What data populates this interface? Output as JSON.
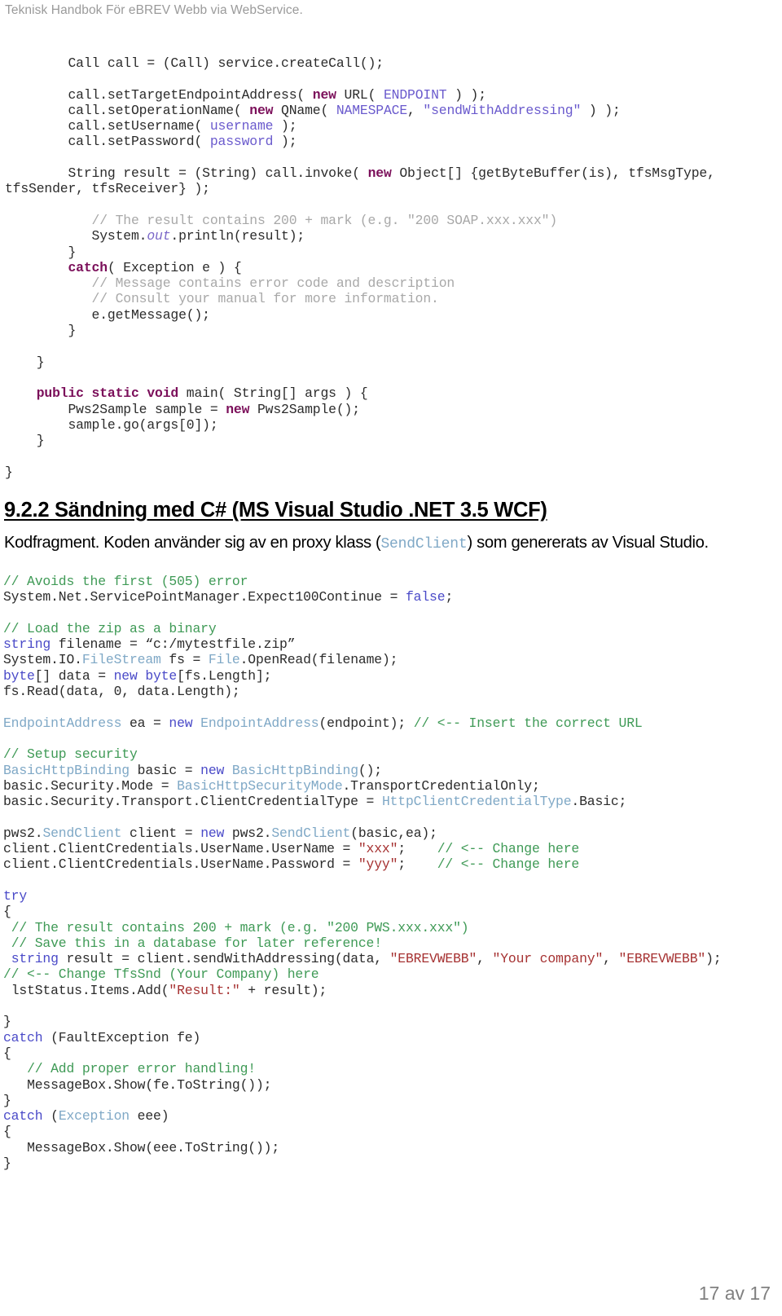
{
  "header": {
    "running_title": "Teknisk Handbok För eBREV Webb via WebService."
  },
  "footer": {
    "page_label": "17 av 17"
  },
  "colors": {
    "header_text": "#9a9a9a",
    "footer_text": "#808080",
    "java_keyword": "#7b0f5a",
    "java_constant": "#6a5acd",
    "java_comment": "#a8a8a8",
    "csharp_comment": "#3f9a56",
    "csharp_keyword": "#4a4ac8",
    "csharp_type": "#7fa8c6",
    "csharp_string": "#a63232",
    "body_text": "#000000"
  },
  "java_code": {
    "language": "java",
    "lines": [
      "        Call call = (Call) service.createCall();",
      "",
      "        call.setTargetEndpointAddress( new URL( ENDPOINT ) );",
      "        call.setOperationName( new QName( NAMESPACE, \"sendWithAddressing\" ) );",
      "        call.setUsername( username );",
      "        call.setPassword( password );",
      "",
      "        String result = (String) call.invoke( new Object[] {getByteBuffer(is), tfsMsgType, tfsSender, tfsReceiver} );",
      "",
      "           // The result contains 200 + mark (e.g. \"200 SOAP.xxx.xxx\")",
      "           System.out.println(result);",
      "        }",
      "        catch( Exception e ) {",
      "           // Message contains error code and description",
      "           // Consult your manual for more information.",
      "           e.getMessage();",
      "        }",
      "",
      "    }",
      "",
      "    public static void main( String[] args ) {",
      "        Pws2Sample sample = new Pws2Sample();",
      "        sample.go(args[0]);",
      "    }",
      "",
      "}"
    ]
  },
  "section": {
    "heading": "9.2.2 Sändning med C# (MS Visual Studio .NET 3.5 WCF)",
    "intro_before": "Kodfragment. Koden använder sig av en proxy klass (",
    "intro_code": "SendClient",
    "intro_after": ") som genererats av Visual Studio."
  },
  "csharp_code": {
    "language": "csharp",
    "lines": [
      "// Avoids the first (505) error",
      "System.Net.ServicePointManager.Expect100Continue = false;",
      "",
      "// Load the zip as a binary",
      "string filename = “c:/mytestfile.zip”",
      "System.IO.FileStream fs = File.OpenRead(filename);",
      "byte[] data = new byte[fs.Length];",
      "fs.Read(data, 0, data.Length);",
      "",
      "EndpointAddress ea = new EndpointAddress(endpoint); // <-- Insert the correct URL",
      "",
      "// Setup security",
      "BasicHttpBinding basic = new BasicHttpBinding();",
      "basic.Security.Mode = BasicHttpSecurityMode.TransportCredentialOnly;",
      "basic.Security.Transport.ClientCredentialType = HttpClientCredentialType.Basic;",
      "",
      "pws2.SendClient client = new pws2.SendClient(basic,ea);",
      "client.ClientCredentials.UserName.UserName = \"xxx\";    // <-- Change here",
      "client.ClientCredentials.UserName.Password = \"yyy\";    // <-- Change here",
      "",
      "try",
      "{",
      " // The result contains 200 + mark (e.g. \"200 PWS.xxx.xxx\")",
      " // Save this in a database for later reference!",
      " string result = client.sendWithAddressing(data, \"EBREVWEBB\", \"Your company\", \"EBREVWEBB\");",
      "// <-- Change TfsSnd (Your Company) here",
      " lstStatus.Items.Add(\"Result:\" + result);",
      "",
      "}",
      "catch (FaultException fe)",
      "{",
      "   // Add proper error handling!",
      "   MessageBox.Show(fe.ToString());",
      "}",
      "catch (Exception eee)",
      "{",
      "   MessageBox.Show(eee.ToString());",
      "}"
    ]
  }
}
